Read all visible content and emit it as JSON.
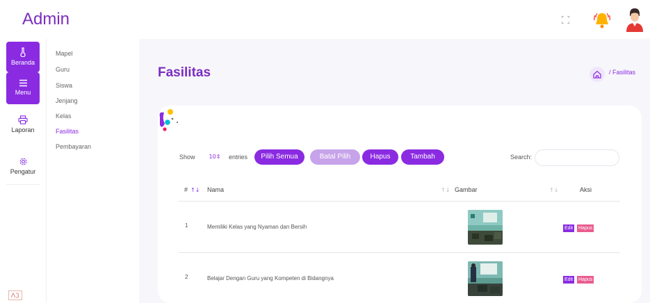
{
  "app": {
    "title": "Admin"
  },
  "rail": {
    "items": [
      {
        "label": "Beranda",
        "icon": "thermometer-icon"
      },
      {
        "label": "Menu",
        "icon": "hamburger-icon"
      },
      {
        "label": "Laporan",
        "icon": "printer-icon"
      },
      {
        "label": "Pengatur",
        "icon": "gear-icon"
      }
    ]
  },
  "submenu": {
    "items": [
      "Mapel",
      "Guru",
      "Siswa",
      "Jenjang",
      "Kelas",
      "Fasilitas",
      "Pembayaran"
    ],
    "active": "Fasilitas"
  },
  "page": {
    "title": "Fasilitas",
    "breadcrumb": "/ Fasilitas"
  },
  "controls": {
    "show_label": "Show",
    "entries_value": "10",
    "entries_label": "entries",
    "pilih_semua": "Pilih Semua",
    "batal_pilih": "Batal Pilih",
    "hapus": "Hapus",
    "tambah": "Tambah",
    "search_label": "Search:",
    "search_value": ""
  },
  "table": {
    "headers": {
      "no": "#",
      "nama": "Nama",
      "gambar": "Gambar",
      "aksi": "Aksi"
    },
    "rows": [
      {
        "no": "1",
        "nama": "Memiliki Kelas yang Nyaman dan Bersih",
        "edit": "Edit",
        "hapus": "Hapus"
      },
      {
        "no": "2",
        "nama": "Belajar Dengan Guru yang Kompeten di Bidangnya",
        "edit": "Edit",
        "hapus": "Hapus"
      }
    ]
  },
  "colors": {
    "accent": "#8a2be2",
    "accent_light": "#c7a3ea",
    "danger": "#e85c8e",
    "background": "#f7f7fb"
  }
}
